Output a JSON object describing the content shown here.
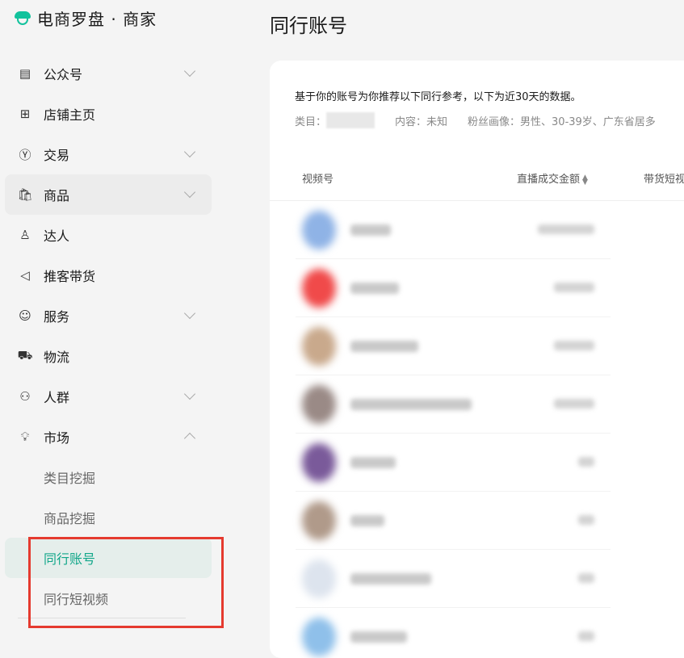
{
  "brand": {
    "title": "电商罗盘 · 商家"
  },
  "sidebar": {
    "items": [
      {
        "label": "公众号",
        "icon": "document-icon",
        "expandable": true
      },
      {
        "label": "店铺主页",
        "icon": "grid-icon",
        "expandable": false
      },
      {
        "label": "交易",
        "icon": "yen-icon",
        "expandable": true
      },
      {
        "label": "商品",
        "icon": "bag-icon",
        "expandable": true
      },
      {
        "label": "达人",
        "icon": "person-icon",
        "expandable": false
      },
      {
        "label": "推客带货",
        "icon": "megaphone-icon",
        "expandable": false
      },
      {
        "label": "服务",
        "icon": "smile-icon",
        "expandable": true
      },
      {
        "label": "物流",
        "icon": "truck-icon",
        "expandable": false
      },
      {
        "label": "人群",
        "icon": "people-icon",
        "expandable": true
      },
      {
        "label": "市场",
        "icon": "bulb-icon",
        "expandable": true,
        "expanded": true
      }
    ],
    "market_sub": [
      {
        "label": "类目挖掘"
      },
      {
        "label": "商品挖掘"
      },
      {
        "label": "同行账号",
        "active": true
      },
      {
        "label": "同行短视频"
      }
    ]
  },
  "page": {
    "title": "同行账号",
    "description": "基于你的账号为你推荐以下同行参考，以下为近30天的数据。",
    "category_label": "类目：",
    "content_label": "内容：未知",
    "fans_label": "粉丝画像：男性、30-39岁、广东省居多"
  },
  "table": {
    "columns": [
      "视频号",
      "直播成交金额",
      "带货短视"
    ]
  },
  "colors": {
    "accent": "#12a78a",
    "highlight_box": "#e53a2f"
  }
}
